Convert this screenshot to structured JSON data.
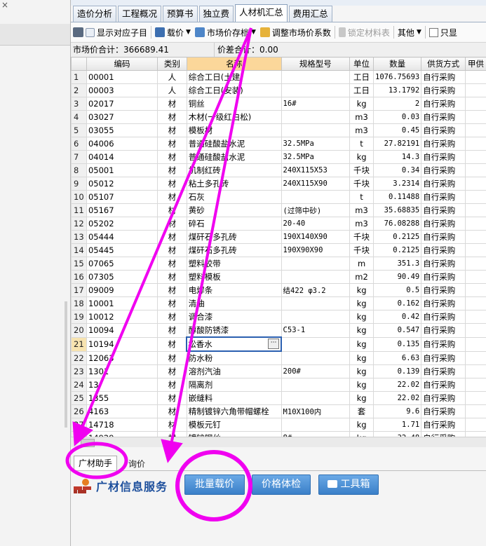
{
  "tabs": [
    "造价分析",
    "工程概况",
    "预算书",
    "独立费",
    "人材机汇总",
    "费用汇总"
  ],
  "active_tab": "人材机汇总",
  "toolbar": {
    "show_sub": "显示对应子目",
    "load_price": "载价",
    "market_store": "市场价存档",
    "adjust_coef": "调整市场价系数",
    "lock_table": "锁定材料表",
    "other": "其他",
    "only_show": "只显"
  },
  "summary": {
    "market_total": "市场价合计：366689.41",
    "diff_total": "价差合计：0.00"
  },
  "columns": [
    "编码",
    "类别",
    "名称",
    "规格型号",
    "单位",
    "数量",
    "供货方式",
    "甲供"
  ],
  "rows": [
    [
      "1",
      "00001",
      "人",
      "综合工日(土建)",
      "",
      "工日",
      "1076.75693",
      "自行采购"
    ],
    [
      "2",
      "00003",
      "人",
      "综合工日(安装)",
      "",
      "工日",
      "13.1792",
      "自行采购"
    ],
    [
      "3",
      "02017",
      "材",
      "铜丝",
      "16#",
      "kg",
      "2",
      "自行采购"
    ],
    [
      "4",
      "03027",
      "材",
      "木材(一级红白松)",
      "",
      "m3",
      "0.03",
      "自行采购"
    ],
    [
      "5",
      "03055",
      "材",
      "模板材",
      "",
      "m3",
      "0.45",
      "自行采购"
    ],
    [
      "6",
      "04006",
      "材",
      "普通硅酸盐水泥",
      "32.5MPa",
      "t",
      "27.82191",
      "自行采购"
    ],
    [
      "7",
      "04014",
      "材",
      "普通硅酸盐水泥",
      "32.5MPa",
      "kg",
      "14.3",
      "自行采购"
    ],
    [
      "8",
      "05001",
      "材",
      "机制红砖",
      "240X115X53",
      "千块",
      "0.34",
      "自行采购"
    ],
    [
      "9",
      "05012",
      "材",
      "粘土多孔砖",
      "240X115X90",
      "千块",
      "3.2314",
      "自行采购"
    ],
    [
      "10",
      "05107",
      "材",
      "石灰",
      "",
      "t",
      "0.11488",
      "自行采购"
    ],
    [
      "11",
      "05167",
      "材",
      "黄砂",
      "(过筛中砂)",
      "m3",
      "35.68835",
      "自行采购"
    ],
    [
      "12",
      "05202",
      "材",
      "碎石",
      "20-40",
      "m3",
      "76.08288",
      "自行采购"
    ],
    [
      "13",
      "05444",
      "材",
      "煤矸石多孔砖",
      "190X140X90",
      "千块",
      "0.2125",
      "自行采购"
    ],
    [
      "14",
      "05445",
      "材",
      "煤矸石多孔砖",
      "190X90X90",
      "千块",
      "0.2125",
      "自行采购"
    ],
    [
      "15",
      "07065",
      "材",
      "塑料胶带",
      "",
      "m",
      "351.3",
      "自行采购"
    ],
    [
      "16",
      "07305",
      "材",
      "塑料模板",
      "",
      "m2",
      "90.49",
      "自行采购"
    ],
    [
      "17",
      "09009",
      "材",
      "电焊条",
      "结422 φ3.2",
      "kg",
      "0.5",
      "自行采购"
    ],
    [
      "18",
      "10001",
      "材",
      "清油",
      "",
      "kg",
      "0.162",
      "自行采购"
    ],
    [
      "19",
      "10012",
      "材",
      "调合漆",
      "",
      "kg",
      "0.42",
      "自行采购"
    ],
    [
      "20",
      "10094",
      "材",
      "醇酸防锈漆",
      "C53-1",
      "kg",
      "0.547",
      "自行采购"
    ],
    [
      "21",
      "10194",
      "材",
      "松香水",
      "",
      "kg",
      "0.135",
      "自行采购"
    ],
    [
      "22",
      "12063",
      "材",
      "防水粉",
      "",
      "kg",
      "6.63",
      "自行采购"
    ],
    [
      "23",
      "1301",
      "材",
      "溶剂汽油",
      "200#",
      "kg",
      "0.139",
      "自行采购"
    ],
    [
      "24",
      "13",
      "材",
      "隔离剂",
      "",
      "kg",
      "22.02",
      "自行采购"
    ],
    [
      "25",
      "1355",
      "材",
      "嵌缝料",
      "",
      "kg",
      "22.02",
      "自行采购"
    ],
    [
      "26",
      "4163",
      "材",
      "精制镀锌六角带帽螺栓",
      "M10X100内",
      "套",
      "9.6",
      "自行采购"
    ],
    [
      "27",
      "14718",
      "材",
      "模板元钉",
      "",
      "kg",
      "1.71",
      "自行采购"
    ],
    [
      "28",
      "14929",
      "材",
      "镀锌钢丝",
      "8#",
      "kg",
      "32.48",
      "自行采购"
    ]
  ],
  "selected_row": "21",
  "bottom_tabs": [
    "广材助手",
    "询价"
  ],
  "service": {
    "brand": "广材信息服务",
    "batch_price": "批量载价",
    "price_check": "价格体检",
    "toolbox": "工具箱"
  },
  "colors": {
    "annotation": "#f000f0",
    "header_highlight": "#fbd79a",
    "button_blue": "#3a7fc8",
    "brand_blue": "#1d4f9c"
  }
}
